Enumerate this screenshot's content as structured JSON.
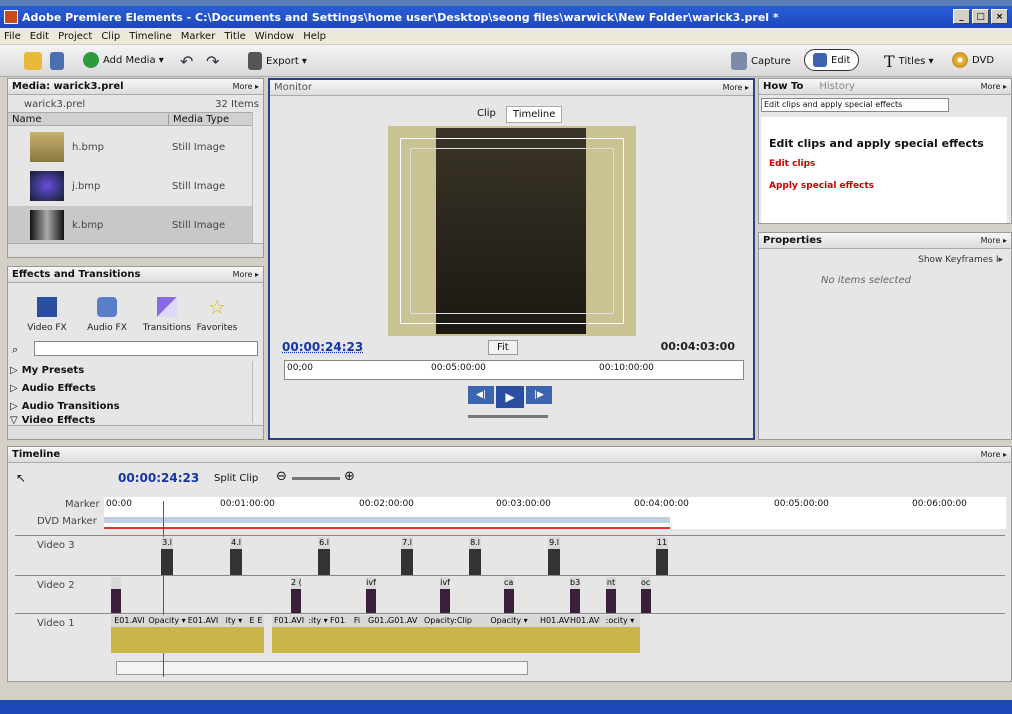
{
  "window": {
    "title": "Adobe Premiere Elements - C:\\Documents and Settings\\home user\\Desktop\\seong files\\warwick\\New Folder\\warick3.prel *",
    "buttons": [
      "_",
      "□",
      "×"
    ]
  },
  "menu": [
    "File",
    "Edit",
    "Project",
    "Clip",
    "Timeline",
    "Marker",
    "Title",
    "Window",
    "Help"
  ],
  "toolbar": {
    "add_media": "Add Media ▾",
    "export": "Export ▾",
    "capture": "Capture",
    "edit": "Edit",
    "titles": "Titles ▾",
    "dvd": "DVD"
  },
  "media": {
    "header": "Media: warick3.prel",
    "more": "More ▸",
    "project": "warick3.prel",
    "count": "32 Items",
    "col_name": "Name",
    "col_type": "Media Type",
    "items": [
      {
        "name": "h.bmp",
        "type": "Still Image"
      },
      {
        "name": "j.bmp",
        "type": "Still Image"
      },
      {
        "name": "k.bmp",
        "type": "Still Image"
      }
    ]
  },
  "effects": {
    "header": "Effects and Transitions",
    "more": "More ▸",
    "buttons": [
      "Video FX",
      "Audio FX",
      "Transitions",
      "Favorites"
    ],
    "tree": [
      "My Presets",
      "Audio Effects",
      "Audio Transitions",
      "Video Effects"
    ]
  },
  "monitor": {
    "header": "Monitor",
    "more": "More ▸",
    "tab_clip": "Clip",
    "tab_timeline": "Timeline",
    "timecode": "00:00:24:23",
    "fit": "Fit",
    "duration": "00:04:03:00",
    "ruler": [
      "00;00",
      "00:05:00:00",
      "00:10:00:00"
    ]
  },
  "howto": {
    "tab1": "How To",
    "tab2": "History",
    "more": "More ▸",
    "dropdown": "Edit clips and apply special effects",
    "title": "Edit clips and apply special effects",
    "links": [
      "Edit clips",
      "Apply special effects"
    ]
  },
  "properties": {
    "header": "Properties",
    "more": "More ▸",
    "show_kf": "Show Keyframes I▸",
    "empty": "No items selected"
  },
  "timeline": {
    "header": "Timeline",
    "more": "More ▸",
    "timecode": "00:00:24:23",
    "split": "Split Clip",
    "marker": "Marker",
    "dvd_marker": "DVD Marker",
    "ruler": [
      "00:00",
      "00:01:00:00",
      "00:02:00:00",
      "00:03:00:00",
      "00:04:00:00",
      "00:05:00:00",
      "00:06:00:00"
    ],
    "tracks": [
      "Video 3",
      "Video 2",
      "Video 1"
    ],
    "v3_clips": [
      "3.l",
      "4.l",
      "6.l",
      "7.l",
      "8.l",
      "9.l",
      "11"
    ],
    "v2_clips": [
      "",
      "2 (",
      "ivf",
      "ivf",
      "cal",
      "b3",
      "nt",
      "ocl"
    ],
    "v1_clips": [
      "E01.AVI",
      "Opacity ▾",
      "E01.AVI",
      "ity ▾",
      "E",
      "E",
      "F01.AVI",
      ":ity ▾",
      "F01.AVI",
      "Fi",
      "G01.AVI",
      "G01.AVI",
      "Opacity:Clip",
      "Opacity ▾",
      "H01.AVI",
      "H01.AVI",
      ":ocity ▾"
    ]
  },
  "colors": {
    "titlebar": "#1c48b8",
    "timecode": "#1435a8",
    "link": "#cc0000",
    "playhead": "#d22"
  }
}
